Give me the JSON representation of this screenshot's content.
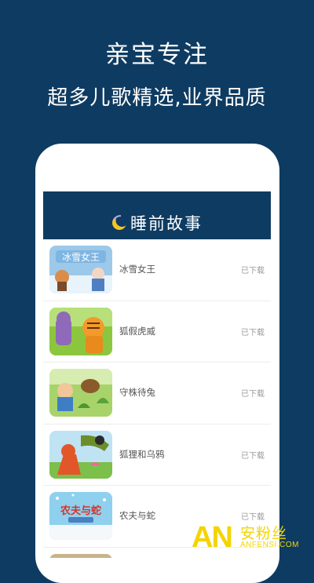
{
  "promo": {
    "headline": "亲宝专注",
    "subheadline": "超多儿歌精选,业界品质"
  },
  "screen": {
    "title": "睡前故事",
    "title_icon": "moon-icon",
    "stories": [
      {
        "title": "冰雪女王",
        "status": "已下载",
        "thumb_text": "冰雪女王"
      },
      {
        "title": "狐假虎威",
        "status": "已下载",
        "thumb_text": ""
      },
      {
        "title": "守株待兔",
        "status": "已下载",
        "thumb_text": ""
      },
      {
        "title": "狐狸和乌鸦",
        "status": "已下载",
        "thumb_text": ""
      },
      {
        "title": "农夫与蛇",
        "status": "已下载",
        "thumb_text": "农夫与蛇"
      }
    ]
  },
  "watermark": {
    "logo": "AN",
    "name": "安粉丝",
    "domain": "ANFENSI.COM"
  },
  "colors": {
    "background": "#0e3b61",
    "watermark": "#f3d400"
  }
}
